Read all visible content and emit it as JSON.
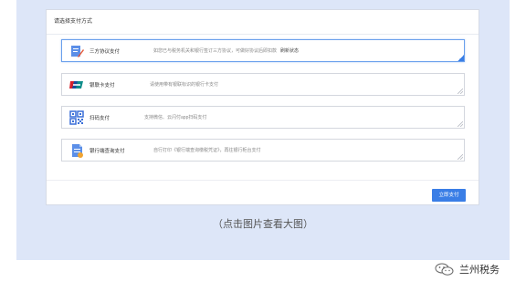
{
  "card": {
    "title": "请选择支付方式",
    "options": [
      {
        "icon": "three-party-agreement-icon",
        "name": "三方协议支付",
        "desc": "如您已与税务机关和银行签订三方协议，可做好协议后即扣款",
        "desc_strong": "刷新状态",
        "selected": true
      },
      {
        "icon": "unionpay-icon",
        "name": "银联卡支付",
        "desc": "请使用带有银联标识的银行卡支付",
        "desc_strong": "",
        "selected": false
      },
      {
        "icon": "qr-code-icon",
        "name": "扫码支付",
        "desc": "支持微信、云闪付app扫码支付",
        "desc_strong": "",
        "selected": false
      },
      {
        "icon": "bank-receipt-icon",
        "name": "银行端查询支付",
        "desc": "自行打印《银行端查询缴税凭证》，再往银行柜台支付",
        "desc_strong": "",
        "selected": false
      }
    ],
    "confirm_label": "立即支付"
  },
  "caption": "（点击图片查看大图）",
  "watermark": {
    "text": "兰州税务",
    "icon": "wechat-icon"
  },
  "colors": {
    "accent": "#3a7ee6",
    "panel_bg": "#dde6f8"
  }
}
